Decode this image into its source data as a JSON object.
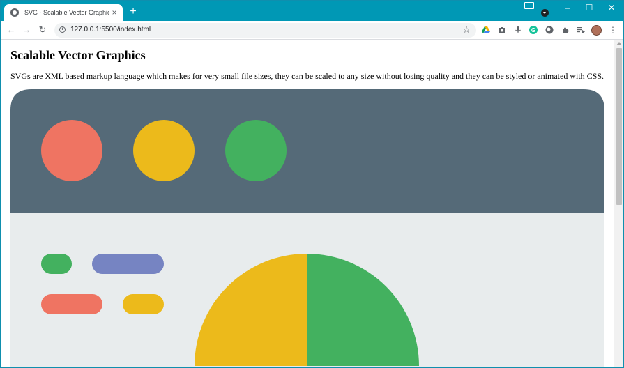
{
  "browser": {
    "tab_title": "SVG - Scalable Vector Graphics",
    "tab_close": "×",
    "new_tab": "+",
    "window_controls": {
      "minimize": "–",
      "maximize": "☐",
      "close": "✕"
    },
    "url": "127.0.0.1:5500/index.html",
    "icons": [
      "back-icon",
      "forward-icon",
      "reload-icon",
      "info-icon",
      "star-icon",
      "drive-icon",
      "camera-icon",
      "microphone-icon",
      "grammarly-icon",
      "circle-extension-icon",
      "puzzle-icon",
      "playlist-icon",
      "avatar-icon",
      "menu-icon"
    ]
  },
  "page": {
    "title": "Scalable Vector Graphics",
    "description": "SVGs are XML based markup language which makes for very small file sizes, they can be scaled to any size without losing quality and they can be styled or animated with CSS."
  },
  "colors": {
    "titlebar": "#0098b5",
    "header_panel": "#556a78",
    "body_panel": "#e8eced",
    "red": "#ef7462",
    "yellow": "#ecba1b",
    "green": "#43b15f",
    "purple": "#7684c2"
  }
}
